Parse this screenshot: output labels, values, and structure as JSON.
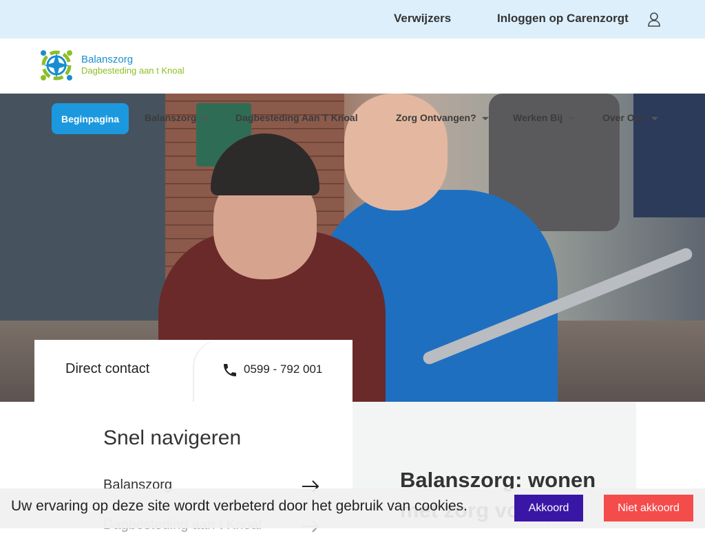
{
  "topbar": {
    "verwijzers": "Verwijzers",
    "login": "Inloggen op Carenzorgt"
  },
  "brand": {
    "line1": "Balanszorg",
    "line2": "Dagbesteding aan t Knoal",
    "colors": {
      "blue": "#1a8dd0",
      "green": "#8cbf26"
    }
  },
  "nav": {
    "items": [
      {
        "label": "Beginpagina",
        "active": true
      },
      {
        "label": "Balanszorg",
        "dropdown": true
      },
      {
        "label": "Dagbesteding Aan T Knoal",
        "dropdown": false
      },
      {
        "label": "Zorg Ontvangen?",
        "dropdown": true
      },
      {
        "label": "Werken Bij",
        "dropdown": true
      },
      {
        "label": "Over Ons",
        "dropdown": true
      }
    ]
  },
  "contact": {
    "label": "Direct contact",
    "phone": "0599 - 792 001"
  },
  "snel": {
    "title": "Snel navigeren",
    "links": [
      "Balanszorg",
      "Dagbesteding aan t Knoal"
    ]
  },
  "feature": {
    "title": "Balanszorg: wonen met zorg voor jou"
  },
  "cookie": {
    "message": "Uw ervaring op deze site wordt verbeterd door het gebruik van cookies.",
    "accept": "Akkoord",
    "decline": "Niet akkoord",
    "colors": {
      "accept": "#3a16a6",
      "decline": "#f44b4b"
    }
  }
}
